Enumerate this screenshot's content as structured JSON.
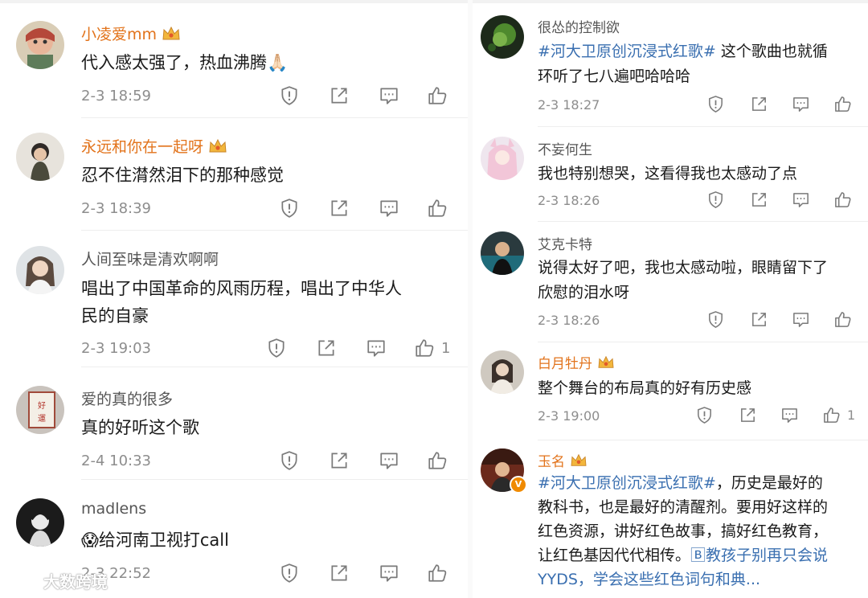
{
  "left": {
    "comments": [
      {
        "name": "小凌爱mm",
        "vip": true,
        "text": "代入感太强了，热血沸腾🙏🏻",
        "time": "2-3 18:59",
        "likes": ""
      },
      {
        "name": "永远和你在一起呀",
        "vip": true,
        "text": "忍不住潸然泪下的那种感觉",
        "time": "2-3 18:39",
        "likes": ""
      },
      {
        "name": "人间至味是清欢啊啊",
        "vip": false,
        "text_lines": [
          "唱出了中国革命的风雨历程，唱出了中华人",
          "民的自豪"
        ],
        "time": "2-3 19:03",
        "likes": "1"
      },
      {
        "name": "爱的真的很多",
        "vip": false,
        "text": "真的好听这个歌",
        "time": "2-4 10:33",
        "likes": ""
      },
      {
        "name": "madlens",
        "vip": false,
        "text": "😱给河南卫视打call",
        "time": "2-3 22:52",
        "likes": ""
      }
    ]
  },
  "right": {
    "comments": [
      {
        "name": "很怂的控制欲",
        "vip": false,
        "topic": "#河大卫原创沉浸式红歌#",
        "text_a": " 这个歌曲也就循",
        "text_b": "环听了七八遍吧哈哈哈",
        "time": "2-3 18:27",
        "likes": ""
      },
      {
        "name": "不妄何生",
        "vip": false,
        "text": "我也特别想哭，这看得我也太感动了点",
        "time": "2-3 18:26",
        "likes": ""
      },
      {
        "name": "艾克卡特",
        "vip": false,
        "text_lines": [
          "说得太好了吧，我也太感动啦，眼睛留下了",
          "欣慰的泪水呀"
        ],
        "time": "2-3 18:26",
        "likes": ""
      },
      {
        "name": "白月牡丹",
        "vip": true,
        "text": "整个舞台的布局真的好有历史感",
        "time": "2-3 19:00",
        "likes": "1"
      },
      {
        "name": "玉名",
        "vip": true,
        "verified_badge": "V",
        "topic": "#河大卫原创沉浸式红歌#",
        "text_a": "，历史是最好的",
        "line2": "教科书，也是最好的清醒剂。要用好这样的",
        "line3": "红色资源，讲好红色故事，搞好红色教育，",
        "line4_a": "让红色基因代代相传。",
        "line4_link": "🄱教孩子别再只会说",
        "line5_link": "YYDS，学会这些红色词句和典..."
      }
    ]
  },
  "watermark": {
    "text": "大数跨境"
  },
  "icons": [
    "report-icon",
    "share-icon",
    "comment-icon",
    "like-icon"
  ],
  "colors": {
    "vip_name": "#e2731b",
    "topic": "#3a6fb0",
    "time": "#8d8d8d"
  }
}
